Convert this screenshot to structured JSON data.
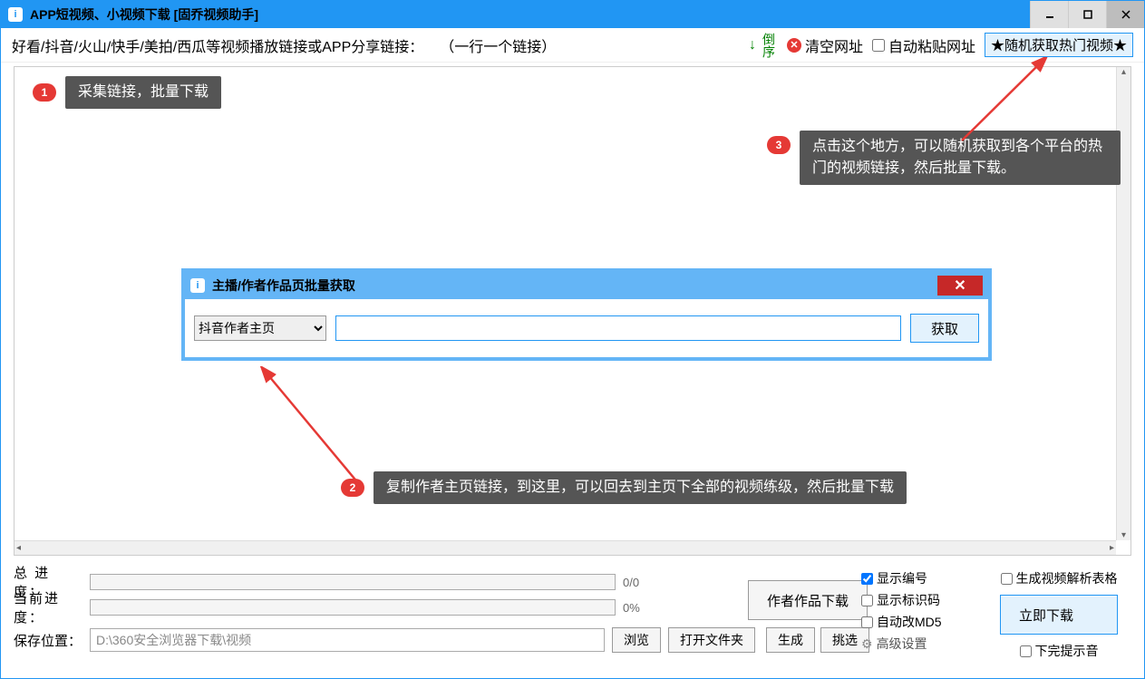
{
  "titlebar": {
    "title": "APP短视频、小视频下载 [固乔视频助手]"
  },
  "toolbar": {
    "instruction": "好看/抖音/火山/快手/美拍/西瓜等视频播放链接或APP分享链接：",
    "hint": "（一行一个链接）",
    "sort_label": "倒序",
    "clear_label": "清空网址",
    "autopaste_label": "自动粘贴网址",
    "random_label": "★随机获取热门视频★"
  },
  "callouts": {
    "c1": "采集链接，批量下载",
    "c2": "复制作者主页链接，到这里，可以回去到主页下全部的视频练级，然后批量下载",
    "c3": "点击这个地方，可以随机获取到各个平台的热门的视频链接，然后批量下载。"
  },
  "dialog": {
    "title": "主播/作者作品页批量获取",
    "select_value": "抖音作者主页",
    "input_value": "",
    "fetch_label": "获取"
  },
  "bottom": {
    "total_label": "总 进 度：",
    "total_val": "0/0",
    "current_label": "当前进度：",
    "current_val": "0%",
    "save_label": "保存位置：",
    "save_path": "D:\\360安全浏览器下载\\视频",
    "browse": "浏览",
    "open_folder": "打开文件夹",
    "author_download": "作者作品下载",
    "generate": "生成",
    "pick": "挑选",
    "show_number": "显示编号",
    "show_id": "显示标识码",
    "auto_md5": "自动改MD5",
    "advanced": "高级设置",
    "gen_table": "生成视频解析表格",
    "download_now": "立即下载",
    "done_sound": "下完提示音"
  }
}
